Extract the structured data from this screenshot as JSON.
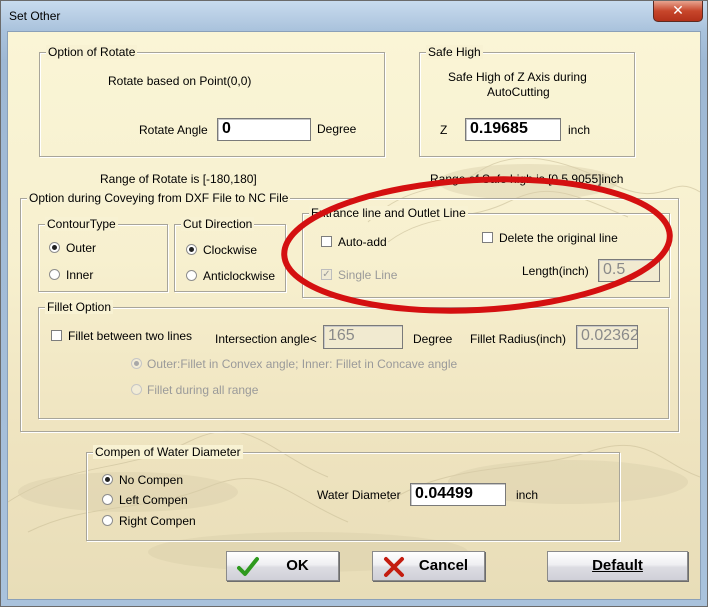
{
  "window": {
    "title": "Set Other",
    "close_glyph": "✕"
  },
  "rotate": {
    "group_title": "Option of Rotate",
    "description": "Rotate based on Point(0,0)",
    "angle_label": "Rotate Angle",
    "angle_value": "0",
    "unit": "Degree",
    "range_text": "Range of Rotate is [-180,180]"
  },
  "safe_high": {
    "group_title": "Safe High",
    "description_line1": "Safe High of Z Axis during",
    "description_line2": "AutoCutting",
    "z_label": "Z",
    "z_value": "0.19685",
    "unit": "inch",
    "range_text": "Range of Safe high is [0.5,9055]inch"
  },
  "dxf_option": {
    "group_title": "Option during Coveying from DXF File to NC File",
    "contour_type": {
      "title": "ContourType",
      "options": [
        {
          "label": "Outer",
          "checked": true
        },
        {
          "label": "Inner",
          "checked": false
        }
      ]
    },
    "cut_direction": {
      "title": "Cut Direction",
      "options": [
        {
          "label": "Clockwise",
          "checked": true
        },
        {
          "label": "Anticlockwise",
          "checked": false
        }
      ]
    },
    "entrance": {
      "title": "Entrance line and Outlet Line",
      "auto_add_label": "Auto-add",
      "auto_add_checked": false,
      "single_line_label": "Single Line",
      "single_line_checked": true,
      "delete_original_label": "Delete the original line",
      "delete_original_checked": false,
      "length_label": "Length(inch)",
      "length_value": "0.5"
    },
    "fillet": {
      "title": "Fillet Option",
      "between_lines_label": "Fillet between two lines",
      "between_lines_checked": false,
      "intersection_label": "Intersection angle<",
      "intersection_value": "165",
      "intersection_unit": "Degree",
      "radius_label": "Fillet Radius(inch)",
      "radius_value": "0.02362",
      "option_convex": "Outer:Fillet in Convex angle; Inner: Fillet in Concave angle",
      "option_all_range": "Fillet during all range"
    }
  },
  "water": {
    "group_title": "Compen of Water Diameter",
    "options": [
      {
        "label": "No Compen",
        "checked": true
      },
      {
        "label": "Left Compen",
        "checked": false
      },
      {
        "label": "Right Compen",
        "checked": false
      }
    ],
    "diameter_label": "Water Diameter",
    "diameter_value": "0.04499",
    "unit": "inch"
  },
  "buttons": {
    "ok": "OK",
    "cancel": "Cancel",
    "default": "Default"
  },
  "colors": {
    "annotation_ellipse": "#d41010",
    "ok_check": "#2f9a1e",
    "cancel_x": "#c41c10"
  }
}
